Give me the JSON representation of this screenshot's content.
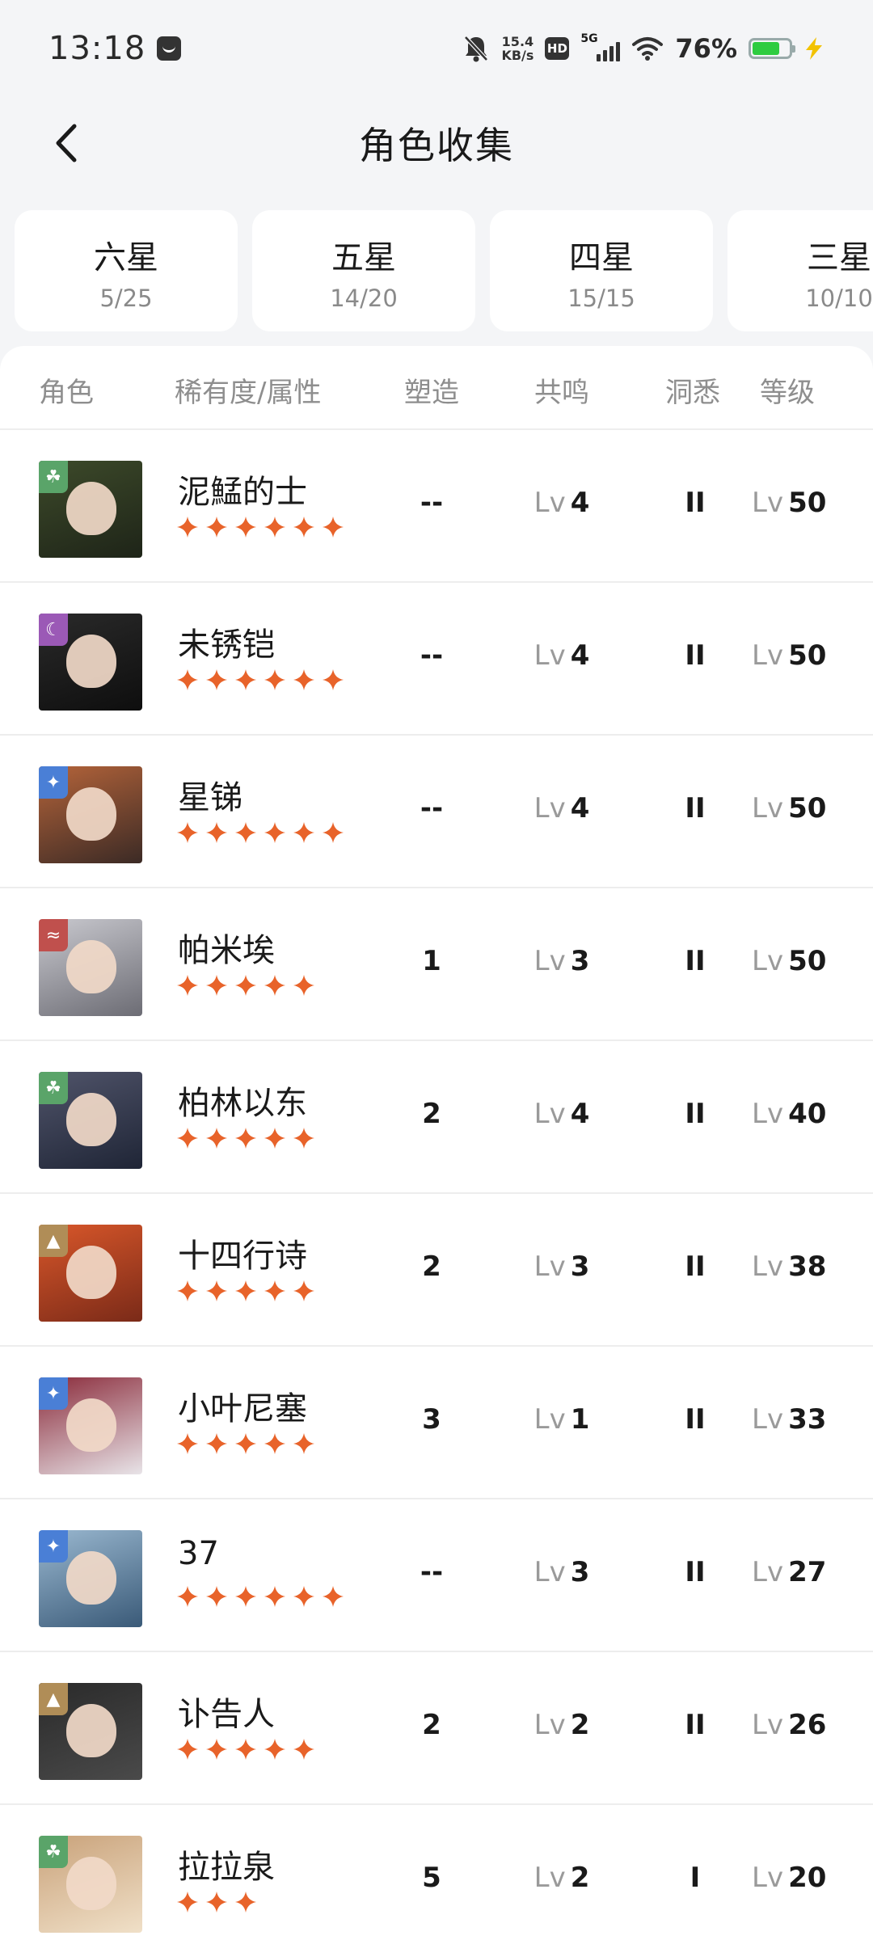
{
  "status_bar": {
    "time": "13:18",
    "net_speed_value": "15.4",
    "net_speed_unit": "KB/s",
    "hd_label": "HD",
    "signal_label": "5G",
    "battery_percent": "76%",
    "battery_level": 0.76,
    "icons": [
      "message-icon",
      "mute-bell-icon",
      "hd-icon",
      "signal-icon",
      "wifi-icon",
      "battery-icon",
      "charging-icon"
    ]
  },
  "header": {
    "title": "角色收集",
    "back_icon": "chevron-left-icon"
  },
  "tabs": [
    {
      "label": "六星",
      "count": "5/25"
    },
    {
      "label": "五星",
      "count": "14/20"
    },
    {
      "label": "四星",
      "count": "15/15"
    },
    {
      "label": "三星",
      "count": "10/10"
    }
  ],
  "table": {
    "headers": {
      "character": "角色",
      "rarity_attr": "稀有度/属性",
      "shaping": "塑造",
      "resonance": "共鸣",
      "insight": "洞悉",
      "level": "等级"
    },
    "level_prefix": "Lv",
    "rows": [
      {
        "name": "泥鯭的士",
        "stars": 6,
        "attr_icon": "leaf-icon",
        "attr_color": "#5aa469",
        "shaping": "--",
        "resonance": "4",
        "insight": "II",
        "level": "50"
      },
      {
        "name": "未锈铠",
        "stars": 6,
        "attr_icon": "moon-icon",
        "attr_color": "#9b59b6",
        "shaping": "--",
        "resonance": "4",
        "insight": "II",
        "level": "50"
      },
      {
        "name": "星锑",
        "stars": 6,
        "attr_icon": "sparkle-icon",
        "attr_color": "#4a7fd6",
        "shaping": "--",
        "resonance": "4",
        "insight": "II",
        "level": "50"
      },
      {
        "name": "帕米埃",
        "stars": 5,
        "attr_icon": "wave-icon",
        "attr_color": "#c0504d",
        "shaping": "1",
        "resonance": "3",
        "insight": "II",
        "level": "50"
      },
      {
        "name": "柏林以东",
        "stars": 5,
        "attr_icon": "leaf-icon",
        "attr_color": "#5aa469",
        "shaping": "2",
        "resonance": "4",
        "insight": "II",
        "level": "40"
      },
      {
        "name": "十四行诗",
        "stars": 5,
        "attr_icon": "rock-icon",
        "attr_color": "#b08d57",
        "shaping": "2",
        "resonance": "3",
        "insight": "II",
        "level": "38"
      },
      {
        "name": "小叶尼塞",
        "stars": 5,
        "attr_icon": "sparkle-icon",
        "attr_color": "#4a7fd6",
        "shaping": "3",
        "resonance": "1",
        "insight": "II",
        "level": "33"
      },
      {
        "name": "37",
        "stars": 6,
        "attr_icon": "sparkle-icon",
        "attr_color": "#4a7fd6",
        "shaping": "--",
        "resonance": "3",
        "insight": "II",
        "level": "27"
      },
      {
        "name": "讣告人",
        "stars": 5,
        "attr_icon": "rock-icon",
        "attr_color": "#b08d57",
        "shaping": "2",
        "resonance": "2",
        "insight": "II",
        "level": "26"
      },
      {
        "name": "拉拉泉",
        "stars": 3,
        "attr_icon": "leaf-icon",
        "attr_color": "#5aa469",
        "shaping": "5",
        "resonance": "2",
        "insight": "I",
        "level": "20"
      }
    ]
  },
  "colors": {
    "star": "#e8632a",
    "page_bg": "#f4f5f7"
  }
}
